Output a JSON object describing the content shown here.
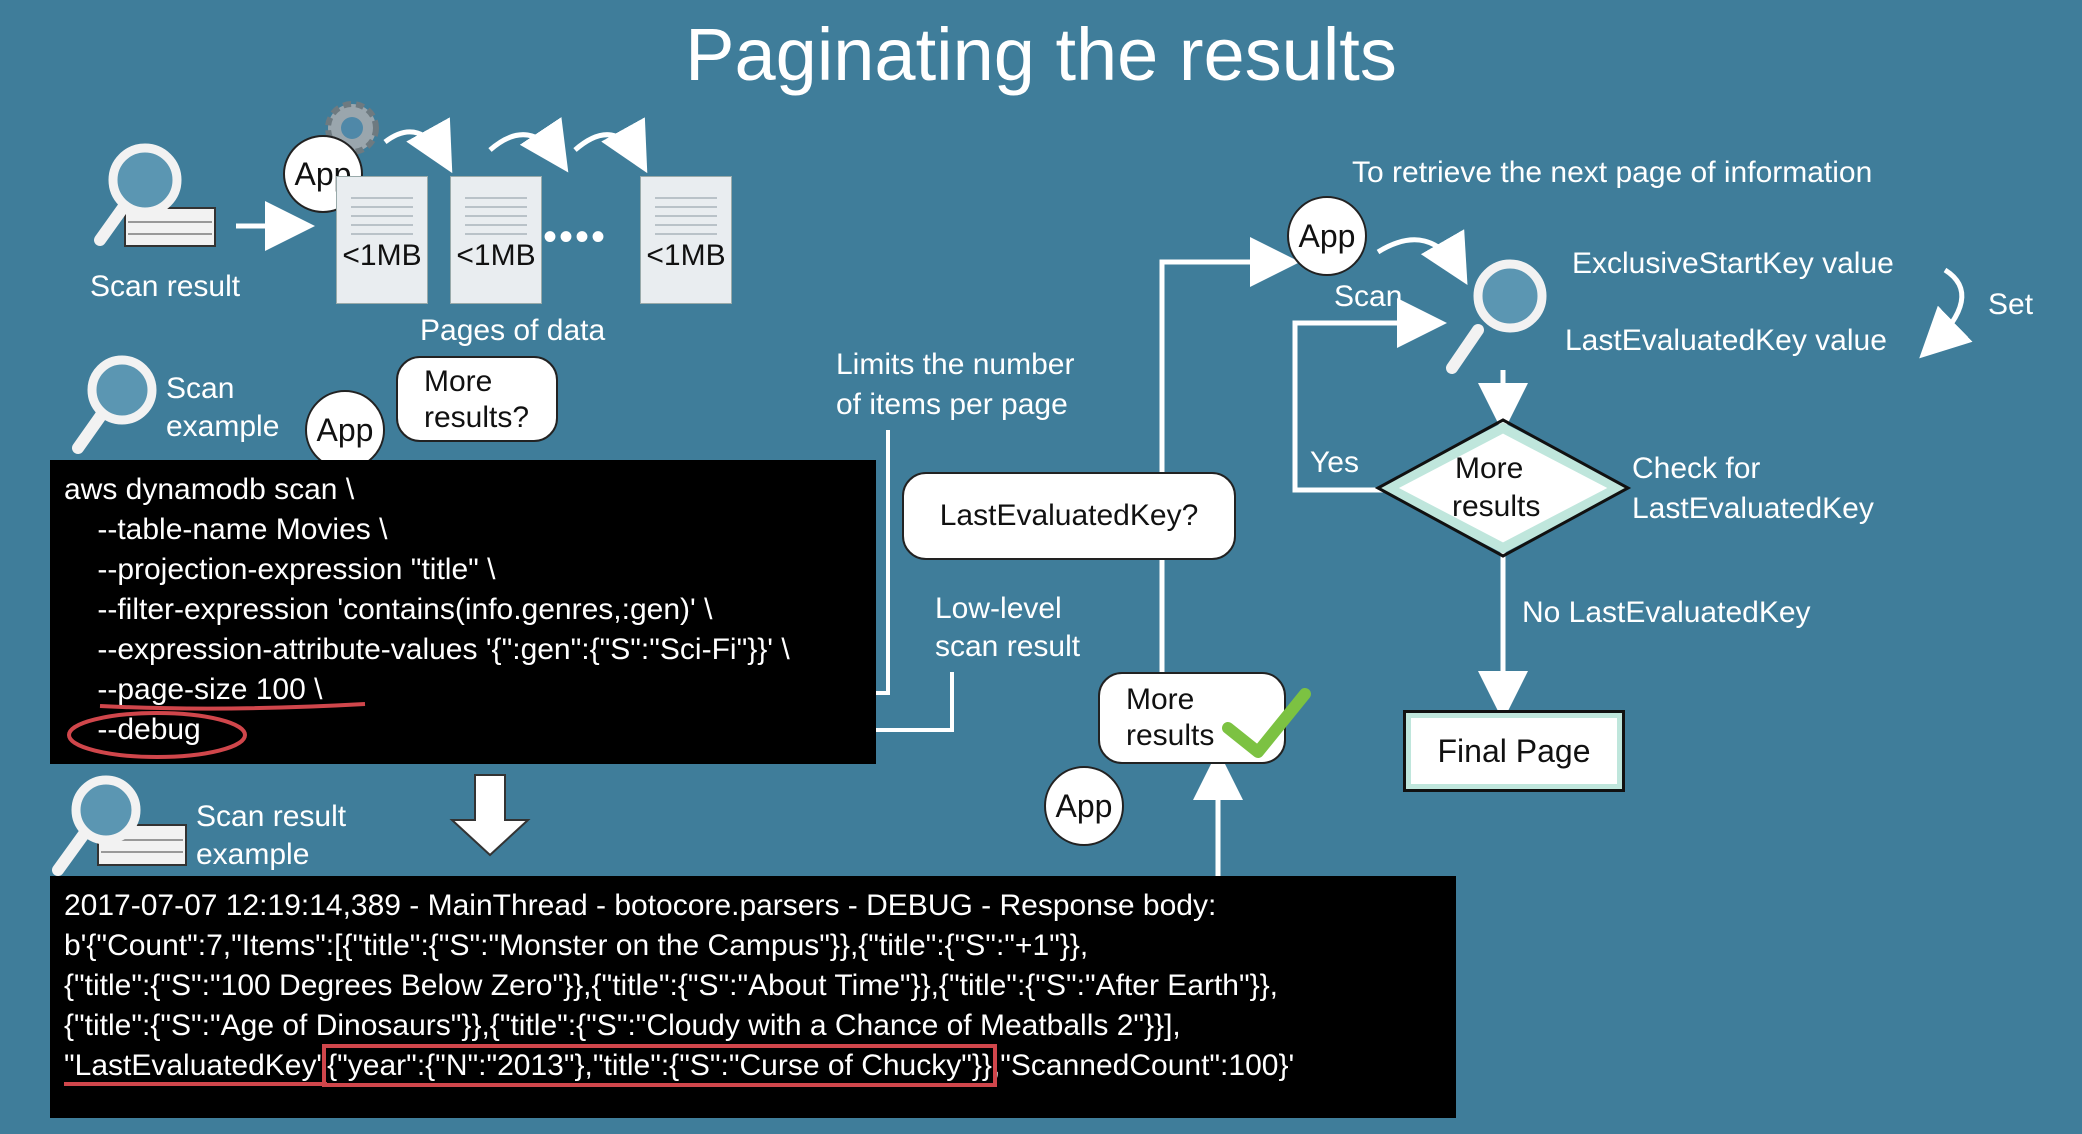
{
  "title": "Paginating the results",
  "top": {
    "scan_result_label": "Scan result",
    "app_label": "App",
    "page_labels": [
      "<1MB",
      "<1MB",
      "<1MB"
    ],
    "ellipsis": "••••",
    "pages_of_data_label": "Pages of data"
  },
  "scan_example": {
    "label_line1": "Scan",
    "label_line2": "example",
    "app_label": "App",
    "bubble_line1": "More",
    "bubble_line2": "results?"
  },
  "command": {
    "lines": [
      "aws dynamodb scan \\",
      "    --table-name Movies \\",
      "    --projection-expression \"title\" \\",
      "    --filter-expression 'contains(info.genres,:gen)' \\",
      "    --expression-attribute-values '{\":gen\":{\"S\":\"Sci-Fi\"}}' \\",
      "    --page-size 100 \\",
      "    --debug"
    ]
  },
  "annotations": {
    "limits_line1": "Limits the number",
    "limits_line2": "of items per page",
    "lek_bubble": "LastEvaluatedKey?",
    "lowlevel_line1": "Low-level",
    "lowlevel_line2": "scan result"
  },
  "result_example": {
    "label_line1": "Scan result",
    "label_line2": "example",
    "lines": [
      "2017-07-07 12:19:14,389 - MainThread - botocore.parsers - DEBUG - Response body:",
      "b'{\"Count\":7,\"Items\":[{\"title\":{\"S\":\"Monster on the Campus\"}},{\"title\":{\"S\":\"+1\"}},",
      "{\"title\":{\"S\":\"100 Degrees Below Zero\"}},{\"title\":{\"S\":\"About Time\"}},{\"title\":{\"S\":\"After Earth\"}},",
      "{\"title\":{\"S\":\"Age of Dinosaurs\"}},{\"title\":{\"S\":\"Cloudy with a Chance of Meatballs 2\"}}],"
    ],
    "last_line_key": "\"LastEvaluatedKey\"",
    "last_line_value": "{\"year\":{\"N\":\"2013\"},\"title\":{\"S\":\"Curse of Chucky\"}}",
    "last_line_tail": ",\"ScannedCount\":100}'"
  },
  "more_results": {
    "bubble_line1": "More",
    "bubble_line2": "results",
    "app_label": "App"
  },
  "flow": {
    "heading": "To retrieve the next page of information",
    "app_label": "App",
    "scan_label": "Scan",
    "exclusive_start": "ExclusiveStartKey value",
    "set_label": "Set",
    "last_evaluated": "LastEvaluatedKey value",
    "yes_label": "Yes",
    "diamond_line1": "More",
    "diamond_line2": "results",
    "check_line1": "Check for",
    "check_line2": "LastEvaluatedKey",
    "no_label": "No LastEvaluatedKey",
    "final_page": "Final Page"
  },
  "colors": {
    "background": "#3f7d9a",
    "highlight_red": "#d0464b",
    "check_green": "#7cc242",
    "diamond_border": "#bfe6dc"
  },
  "icons": [
    "magnifier-icon",
    "gear-icon",
    "document-icon",
    "checkmark-icon",
    "arrow-icon"
  ]
}
